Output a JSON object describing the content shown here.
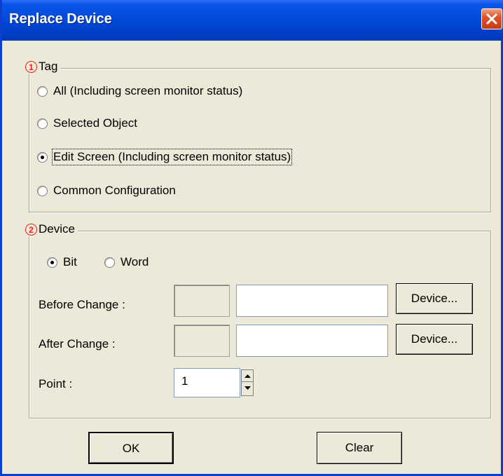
{
  "window": {
    "title": "Replace Device"
  },
  "tag_group": {
    "number": "1",
    "legend": "Tag",
    "options": [
      {
        "label": "All (Including screen monitor status)",
        "selected": false
      },
      {
        "label": "Selected Object",
        "selected": false
      },
      {
        "label": "Edit Screen (Including screen monitor status)",
        "selected": true
      },
      {
        "label": "Common Configuration",
        "selected": false
      }
    ]
  },
  "device_group": {
    "number": "2",
    "legend": "Device",
    "type_options": [
      {
        "label": "Bit",
        "selected": true
      },
      {
        "label": "Word",
        "selected": false
      }
    ],
    "before_change_label": "Before Change :",
    "after_change_label": "After Change :",
    "device_button_label": "Device...",
    "point_label": "Point :",
    "point_value": "1"
  },
  "buttons": {
    "ok": "OK",
    "clear": "Clear"
  }
}
